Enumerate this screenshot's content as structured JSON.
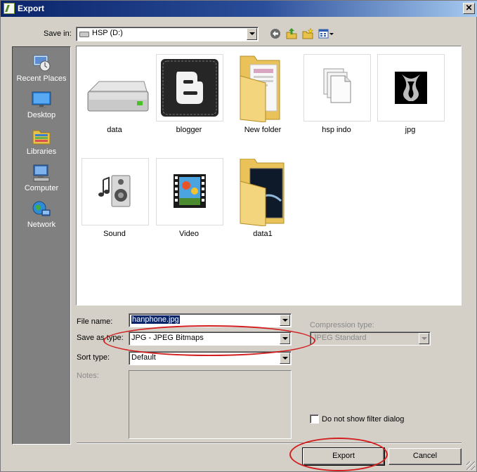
{
  "window": {
    "title": "Export",
    "close_glyph": "✕"
  },
  "save_in": {
    "label": "Save in:",
    "value": "HSP (D:)"
  },
  "toolbar": {
    "icons": [
      "back-icon",
      "up-folder-icon",
      "new-folder-icon",
      "view-menu-icon"
    ]
  },
  "places": [
    {
      "label": "Recent Places",
      "icon": "recent-places-icon"
    },
    {
      "label": "Desktop",
      "icon": "desktop-icon"
    },
    {
      "label": "Libraries",
      "icon": "libraries-icon"
    },
    {
      "label": "Computer",
      "icon": "computer-icon"
    },
    {
      "label": "Network",
      "icon": "network-icon"
    }
  ],
  "files": [
    {
      "name": "data",
      "icon": "drive-icon"
    },
    {
      "name": "blogger",
      "icon": "blogger-icon"
    },
    {
      "name": "New folder",
      "icon": "folder-icon"
    },
    {
      "name": "hsp indo",
      "icon": "documents-icon"
    },
    {
      "name": "jpg",
      "icon": "image-thumbnail-icon"
    },
    {
      "name": "Sound",
      "icon": "sound-icon"
    },
    {
      "name": "Video",
      "icon": "video-icon"
    },
    {
      "name": "data1",
      "icon": "folder-icon"
    }
  ],
  "form": {
    "file_name_label": "File name:",
    "file_name_value": "hanphone.jpg",
    "save_as_type_label": "Save as type:",
    "save_as_type_value": "JPG - JPEG Bitmaps",
    "sort_type_label": "Sort type:",
    "sort_type_value": "Default",
    "notes_label": "Notes:",
    "compression_label": "Compression type:",
    "compression_value": "JPEG Standard",
    "filter_checkbox_label": "Do not show filter dialog"
  },
  "buttons": {
    "export": "Export",
    "cancel": "Cancel"
  },
  "colors": {
    "annotation": "#d21e1e",
    "title_bar": "#0a246a",
    "dialog_bg": "#d4d0c8"
  }
}
